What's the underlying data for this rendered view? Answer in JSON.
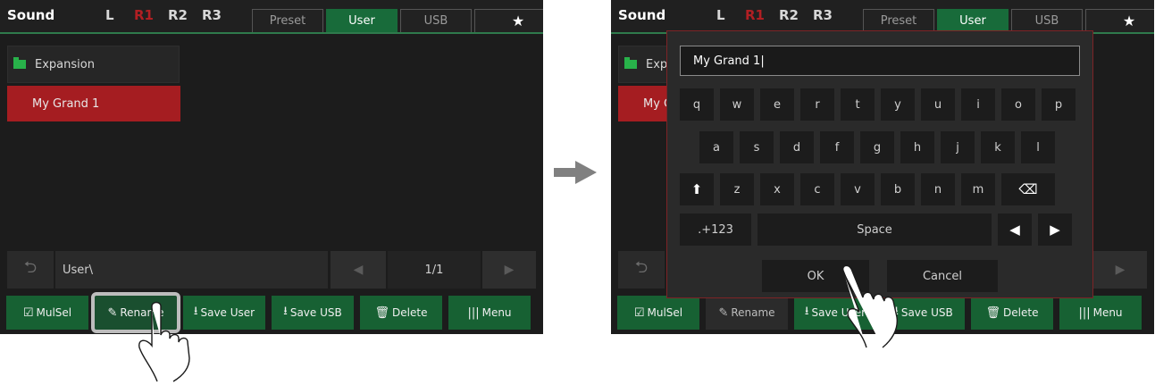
{
  "header": {
    "title": "Sound",
    "registrations": [
      "L",
      "R1",
      "R2",
      "R3"
    ],
    "tabs": [
      "Preset",
      "User",
      "USB"
    ],
    "star": "★"
  },
  "list": {
    "folder": "Expansion",
    "file": "My Grand 1"
  },
  "path": {
    "label": "User\\",
    "page": "1/1"
  },
  "buttons": {
    "mulsel": "MulSel",
    "rename": "Rename",
    "save_user": "Save User",
    "save_usb": "Save USB",
    "delete": "Delete",
    "menu": "Menu"
  },
  "keyboard": {
    "input_value": "My Grand 1|",
    "row1": [
      "q",
      "w",
      "e",
      "r",
      "t",
      "y",
      "u",
      "i",
      "o",
      "p"
    ],
    "row2": [
      "a",
      "s",
      "d",
      "f",
      "g",
      "h",
      "j",
      "k",
      "l"
    ],
    "row3": [
      "z",
      "x",
      "c",
      "v",
      "b",
      "n",
      "m"
    ],
    "mode_key": ".+123",
    "space_key": "Space",
    "ok": "OK",
    "cancel": "Cancel"
  },
  "colors": {
    "accent_green": "#176133",
    "selected_red": "#a51d21",
    "tab_active": "#186b3a"
  }
}
